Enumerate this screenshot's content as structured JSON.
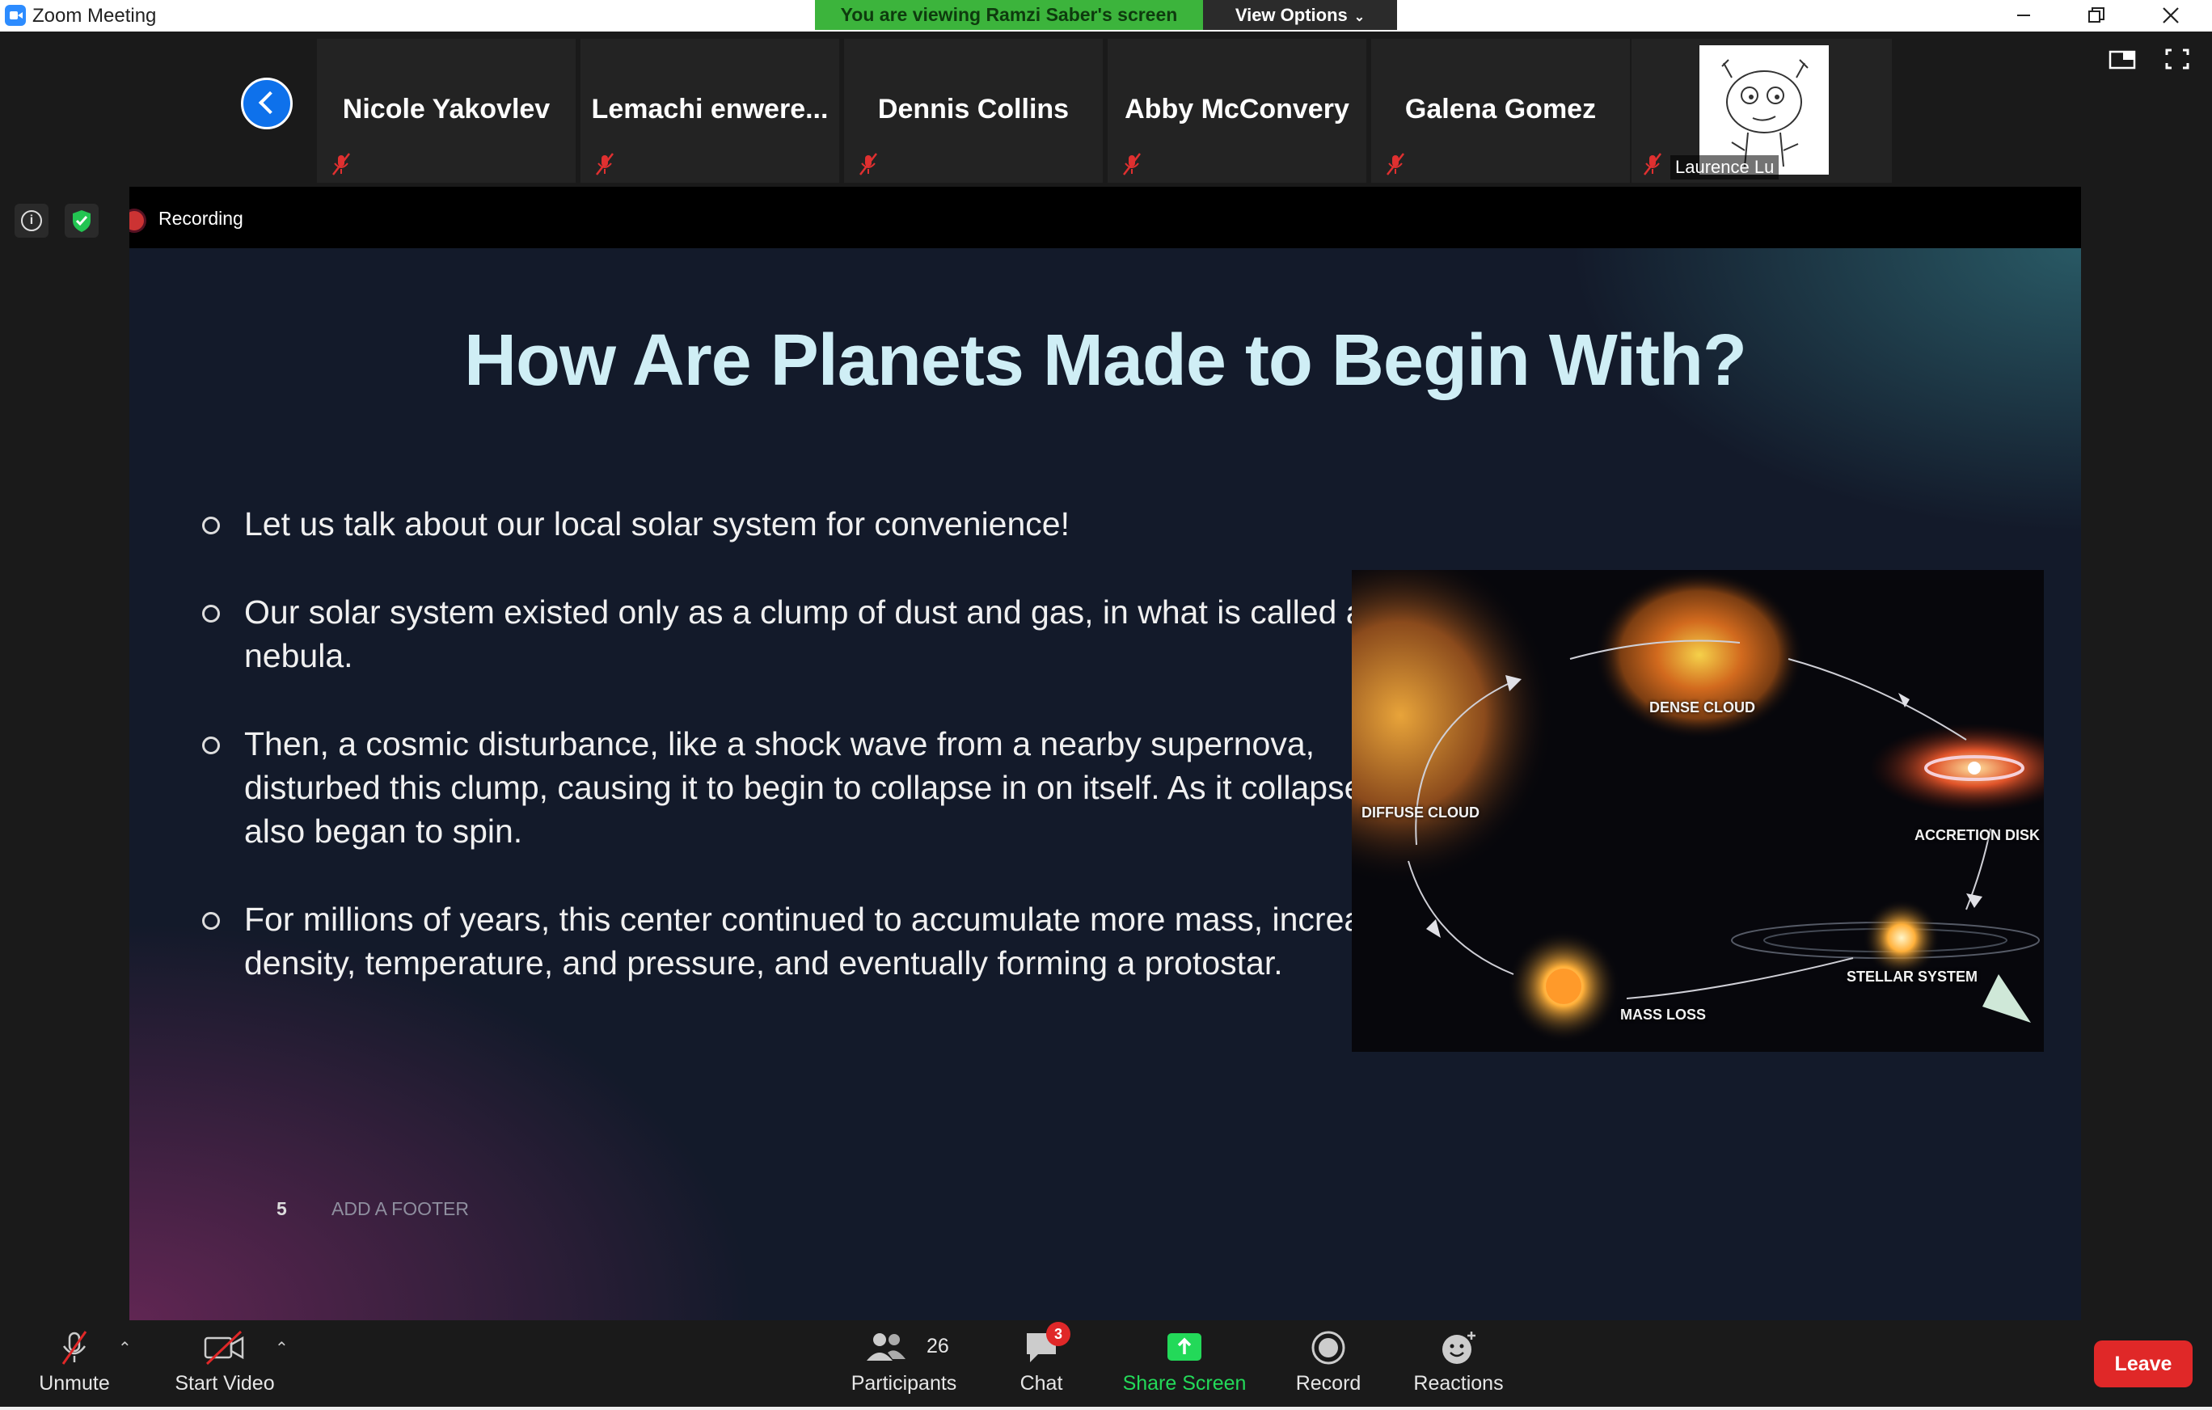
{
  "window": {
    "title": "Zoom Meeting",
    "viewing_banner": "You are viewing Ramzi Saber's screen",
    "view_options": "View Options"
  },
  "participants": [
    {
      "name": "Nicole Yakovlev"
    },
    {
      "name": "Lemachi  enwere..."
    },
    {
      "name": "Dennis Collins"
    },
    {
      "name": "Abby McConvery"
    },
    {
      "name": "Galena Gomez"
    },
    {
      "name": "Laurence Lu"
    }
  ],
  "recording": {
    "label": "Recording"
  },
  "slide": {
    "title": "How Are Planets Made to Begin With?",
    "bullets": [
      "Let us talk about our local solar system for convenience!",
      "Our solar system existed only as a clump of dust and gas, in what is called a nebula.",
      "Then, a cosmic disturbance, like a shock wave from a nearby supernova, disturbed this clump, causing it to begin to collapse in on itself. As it collapsed, it also began to spin.",
      "For millions of years, this center continued to accumulate more mass, increasing in density, temperature, and pressure, and eventually forming a protostar."
    ],
    "page_number": "5",
    "footer": "ADD A FOOTER",
    "diagram_labels": {
      "dense_cloud": "DENSE CLOUD",
      "diffuse_cloud": "DIFFUSE CLOUD",
      "accretion_disk": "ACCRETION DISK",
      "stellar_system": "STELLAR SYSTEM",
      "mass_loss": "MASS LOSS"
    }
  },
  "toolbar": {
    "unmute": "Unmute",
    "start_video": "Start Video",
    "participants": "Participants",
    "participants_count": "26",
    "chat": "Chat",
    "chat_badge": "3",
    "share_screen": "Share Screen",
    "record": "Record",
    "reactions": "Reactions",
    "leave": "Leave"
  },
  "colors": {
    "zoom_blue": "#0e71eb",
    "banner_green": "#3cb43c",
    "share_green": "#23d959",
    "leave_red": "#e02828",
    "slide_title": "#cfeef5"
  }
}
